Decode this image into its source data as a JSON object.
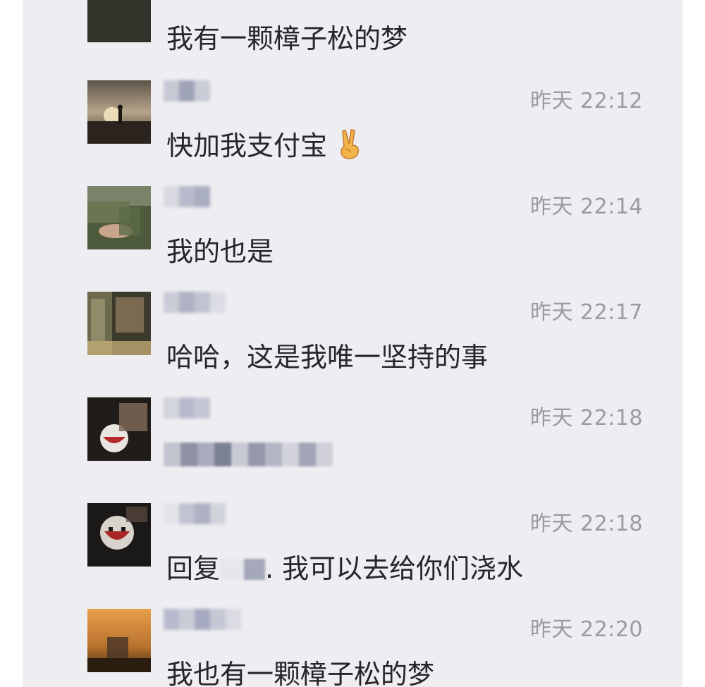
{
  "comments": [
    {
      "time": "",
      "text": "我有一颗樟子松的梦"
    },
    {
      "time": "昨天 22:12",
      "text": "快加我支付宝",
      "emoji": "victory-hand-emoji"
    },
    {
      "time": "昨天 22:14",
      "text": "我的也是"
    },
    {
      "time": "昨天 22:17",
      "text": "哈哈，这是我唯一坚持的事"
    },
    {
      "time": "昨天 22:18",
      "text": ""
    },
    {
      "time": "昨天 22:18",
      "text_prefix": "回复",
      "text_suffix": ". 我可以去给你们浇水"
    },
    {
      "time": "昨天 22:20",
      "text": "我也有一颗樟子松的梦"
    }
  ],
  "colors": {
    "background": "#eeedf1",
    "time_text": "#9b9b9f",
    "body_text": "#262629"
  }
}
